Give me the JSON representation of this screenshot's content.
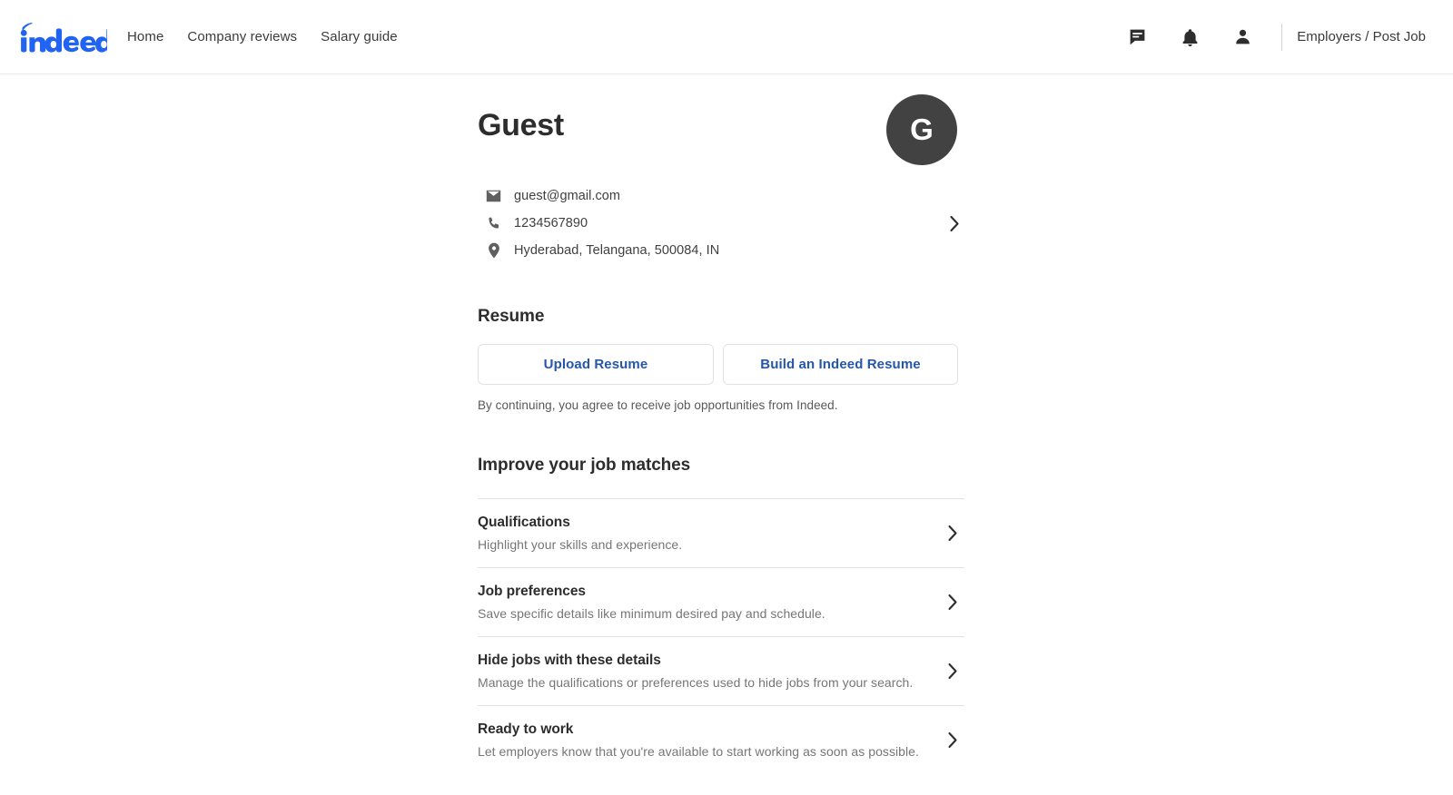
{
  "header": {
    "logo_alt": "indeed",
    "nav": [
      {
        "label": "Home"
      },
      {
        "label": "Company reviews"
      },
      {
        "label": "Salary guide"
      }
    ],
    "icons": [
      {
        "name": "messages-icon"
      },
      {
        "name": "notifications-bell-icon"
      },
      {
        "name": "account-person-icon"
      }
    ],
    "employers_link": "Employers / Post Job"
  },
  "profile": {
    "name": "Guest",
    "avatar_initial": "G",
    "avatar_color": "#424242",
    "contact": {
      "email": "guest@gmail.com",
      "phone": "1234567890",
      "location": "Hyderabad, Telangana, 500084, IN"
    }
  },
  "resume": {
    "title": "Resume",
    "upload_label": "Upload Resume",
    "build_label": "Build an Indeed Resume",
    "disclaimer": "By continuing, you agree to receive job opportunities from Indeed.",
    "link_color": "#2557a7"
  },
  "improve": {
    "title": "Improve your job matches",
    "rows": [
      {
        "title": "Qualifications",
        "desc": "Highlight your skills and experience."
      },
      {
        "title": "Job preferences",
        "desc": "Save specific details like minimum desired pay and schedule."
      },
      {
        "title": "Hide jobs with these details",
        "desc": "Manage the qualifications or preferences used to hide jobs from your search."
      },
      {
        "title": "Ready to work",
        "desc": "Let employers know that you're available to start working as soon as possible."
      }
    ]
  }
}
